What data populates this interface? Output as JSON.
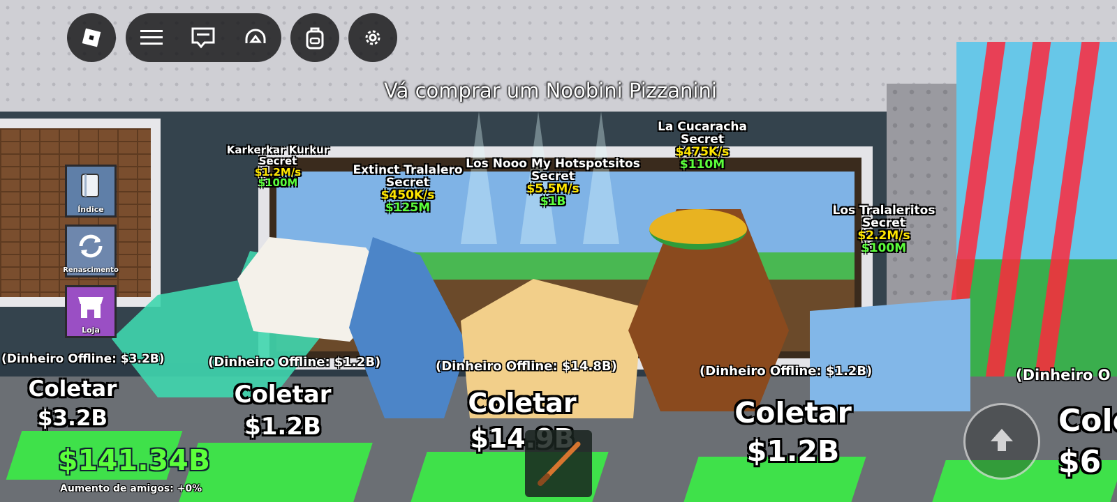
{
  "hud": {
    "roblox_icon": "roblox-logo-icon",
    "menu_icon": "hamburger-menu-icon",
    "chat_icon": "chat-icon",
    "voice_icon": "headphones-icon",
    "backpack_icon": "backpack-icon",
    "settings_icon": "gear-icon"
  },
  "objective": "Vá comprar um Noobini Pizzanini",
  "side_buttons": [
    {
      "label": "Índice",
      "icon": "book-icon",
      "color": "#5f7fa8"
    },
    {
      "label": "Renascimento",
      "icon": "refresh-icon",
      "color": "#6e87ad"
    },
    {
      "label": "Loja",
      "icon": "shop-icon",
      "color": "#9a4fc4"
    }
  ],
  "overhead_labels": [
    {
      "name": "Karkerkar Kurkur",
      "rarity": "Secret",
      "rate": "$1.2M/s",
      "price": "$100M"
    },
    {
      "name": "Extinct Tralalero",
      "rarity": "Secret",
      "rate": "$450K/s",
      "price": "$125M"
    },
    {
      "name": "Los Nooo My Hotspotsitos",
      "rarity": "Secret",
      "rate": "$5.5M/s",
      "price": "$1B"
    },
    {
      "name": "La Cucaracha",
      "rarity": "Secret",
      "rate": "$475K/s",
      "price": "$110M"
    },
    {
      "name": "Los Tralaleritos",
      "rarity": "Secret",
      "rate": "$2.2M/s",
      "price": "$100M"
    }
  ],
  "offline_money": [
    "(Dinheiro Offline: $3.2B)",
    "(Dinheiro Offline: $1.2B)",
    "(Dinheiro Offline: $14.8B)",
    "(Dinheiro Offline: $1.2B)",
    "(Dinheiro O"
  ],
  "collect": [
    {
      "label": "Coletar",
      "amount": "$3.2B"
    },
    {
      "label": "Coletar",
      "amount": "$1.2B"
    },
    {
      "label": "Coletar",
      "amount": "$14.9B"
    },
    {
      "label": "Coletar",
      "amount": "$1.2B"
    },
    {
      "label": "Cole",
      "amount": "$6"
    }
  ],
  "player": {
    "money": "$141.34B",
    "friends_boost": "Aumento de amigos: +0%"
  },
  "hotbar": {
    "item_icon": "baseball-bat-icon"
  },
  "jump_icon": "jump-arrow-icon",
  "colors": {
    "money_green": "#5cff3b",
    "rate_yellow": "#ffe600",
    "laser_red": "#ff2a3c",
    "pad_green": "#3fe14a"
  }
}
